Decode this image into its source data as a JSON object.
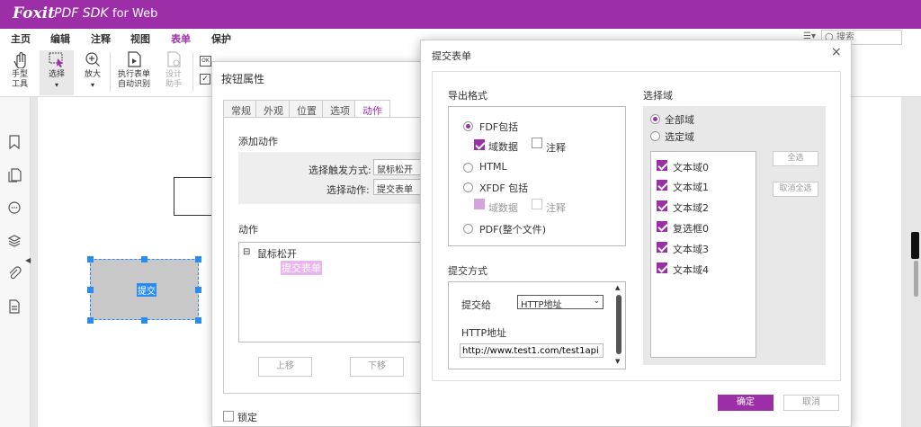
{
  "app": {
    "brand": "Foxit",
    "product": "PDF SDK",
    "product_suffix": "for Web",
    "accent": "#9c2fa8"
  },
  "menu": [
    "主页",
    "编辑",
    "注释",
    "视图",
    "表单",
    "保护"
  ],
  "menu_active_index": 4,
  "search": {
    "placeholder": "搜索"
  },
  "toolbar": {
    "hand": "手型\n工具",
    "select": "选择",
    "zoom": "放大",
    "run_form": "执行表单\n自动识别",
    "design": "设计\n助手"
  },
  "canvas": {
    "submit_field": "提交"
  },
  "button_props": {
    "title": "按钮属性",
    "tabs": [
      "常规",
      "外观",
      "位置",
      "选项",
      "动作"
    ],
    "active_tab": 4,
    "add_action": "添加动作",
    "trigger_label": "选择触发方式:",
    "trigger_value": "鼠标松开",
    "action_label": "选择动作:",
    "action_value": "提交表单",
    "actions_title": "动作",
    "tree_root": "鼠标松开",
    "tree_child": "提交表单",
    "up": "上移",
    "down": "下移",
    "lock": "锁定"
  },
  "submit_form": {
    "title": "提交表单",
    "export_title": "导出格式",
    "fdf": "FDF包括",
    "field_data": "域数据",
    "comments": "注释",
    "html": "HTML",
    "xfdf": "XFDF 包括",
    "pdf": "PDF(整个文件)",
    "submit_method_title": "提交方式",
    "submit_to": "提交给",
    "submit_to_value": "HTTP地址",
    "http_label": "HTTP地址",
    "http_value": "http://www.test1.com/test1api",
    "select_fields_title": "选择域",
    "all_fields": "全部域",
    "selected_fields": "选定域",
    "fields": [
      "文本域0",
      "文本域1",
      "文本域2",
      "复选框0",
      "文本域3",
      "文本域4"
    ],
    "select_all": "全选",
    "deselect_all": "取消全选",
    "ok": "确定",
    "cancel": "取消"
  }
}
